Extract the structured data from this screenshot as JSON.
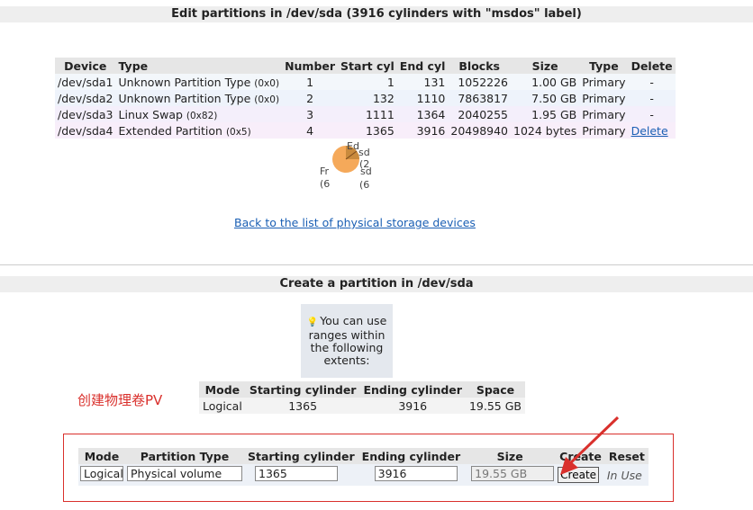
{
  "edit_section": {
    "title": "Edit partitions in /dev/sda (3916 cylinders with \"msdos\" label)",
    "headers": [
      "Device",
      "Type",
      "Number",
      "Start cyl",
      "End cyl",
      "Blocks",
      "Size",
      "Type",
      "Delete"
    ],
    "rows": [
      {
        "device": "/dev/sda1",
        "type": "Unknown Partition Type",
        "code": "(0x0)",
        "number": "1",
        "start": "1",
        "end": "131",
        "blocks": "1052226",
        "size": "1.00 GB",
        "ptype": "Primary",
        "delete": "-"
      },
      {
        "device": "/dev/sda2",
        "type": "Unknown Partition Type",
        "code": "(0x0)",
        "number": "2",
        "start": "132",
        "end": "1110",
        "blocks": "7863817",
        "size": "7.50 GB",
        "ptype": "Primary",
        "delete": "-"
      },
      {
        "device": "/dev/sda3",
        "type": "Linux Swap",
        "code": "(0x82)",
        "number": "3",
        "start": "1111",
        "end": "1364",
        "blocks": "2040255",
        "size": "1.95 GB",
        "ptype": "Primary",
        "delete": "-"
      },
      {
        "device": "/dev/sda4",
        "type": "Extended Partition",
        "code": "(0x5)",
        "number": "4",
        "start": "1365",
        "end": "3916",
        "blocks": "20498940",
        "size": "1024 bytes",
        "ptype": "Primary",
        "delete": "Delete"
      }
    ],
    "chart_labels": {
      "a": "Fr",
      "b": "(6",
      "c": "sd",
      "d": "(2",
      "e": "sd",
      "f": "(6",
      "g": "Ed"
    },
    "back_link": "Back to the list of physical storage devices"
  },
  "create_section": {
    "title": "Create a partition in /dev/sda",
    "info_text": "You can use ranges within the following extents:",
    "extents_headers": [
      "Mode",
      "Starting cylinder",
      "Ending cylinder",
      "Space"
    ],
    "extents_row": {
      "mode": "Logical",
      "start": "1365",
      "end": "3916",
      "space": "19.55 GB"
    },
    "annotation": "创建物理卷PV",
    "form_headers": [
      "Mode",
      "Partition Type",
      "Starting cylinder",
      "Ending cylinder",
      "Size",
      "Create",
      "Reset"
    ],
    "form": {
      "mode": "Logical",
      "partition_type": "Physical volume",
      "start": "1365",
      "end": "3916",
      "size": "19.55 GB",
      "create_label": "Create",
      "in_use": "In Use"
    }
  },
  "colors": {
    "annotation_red": "#d9302c",
    "link_blue": "#1a5fb4",
    "chart_orange": "#f5a95a"
  }
}
